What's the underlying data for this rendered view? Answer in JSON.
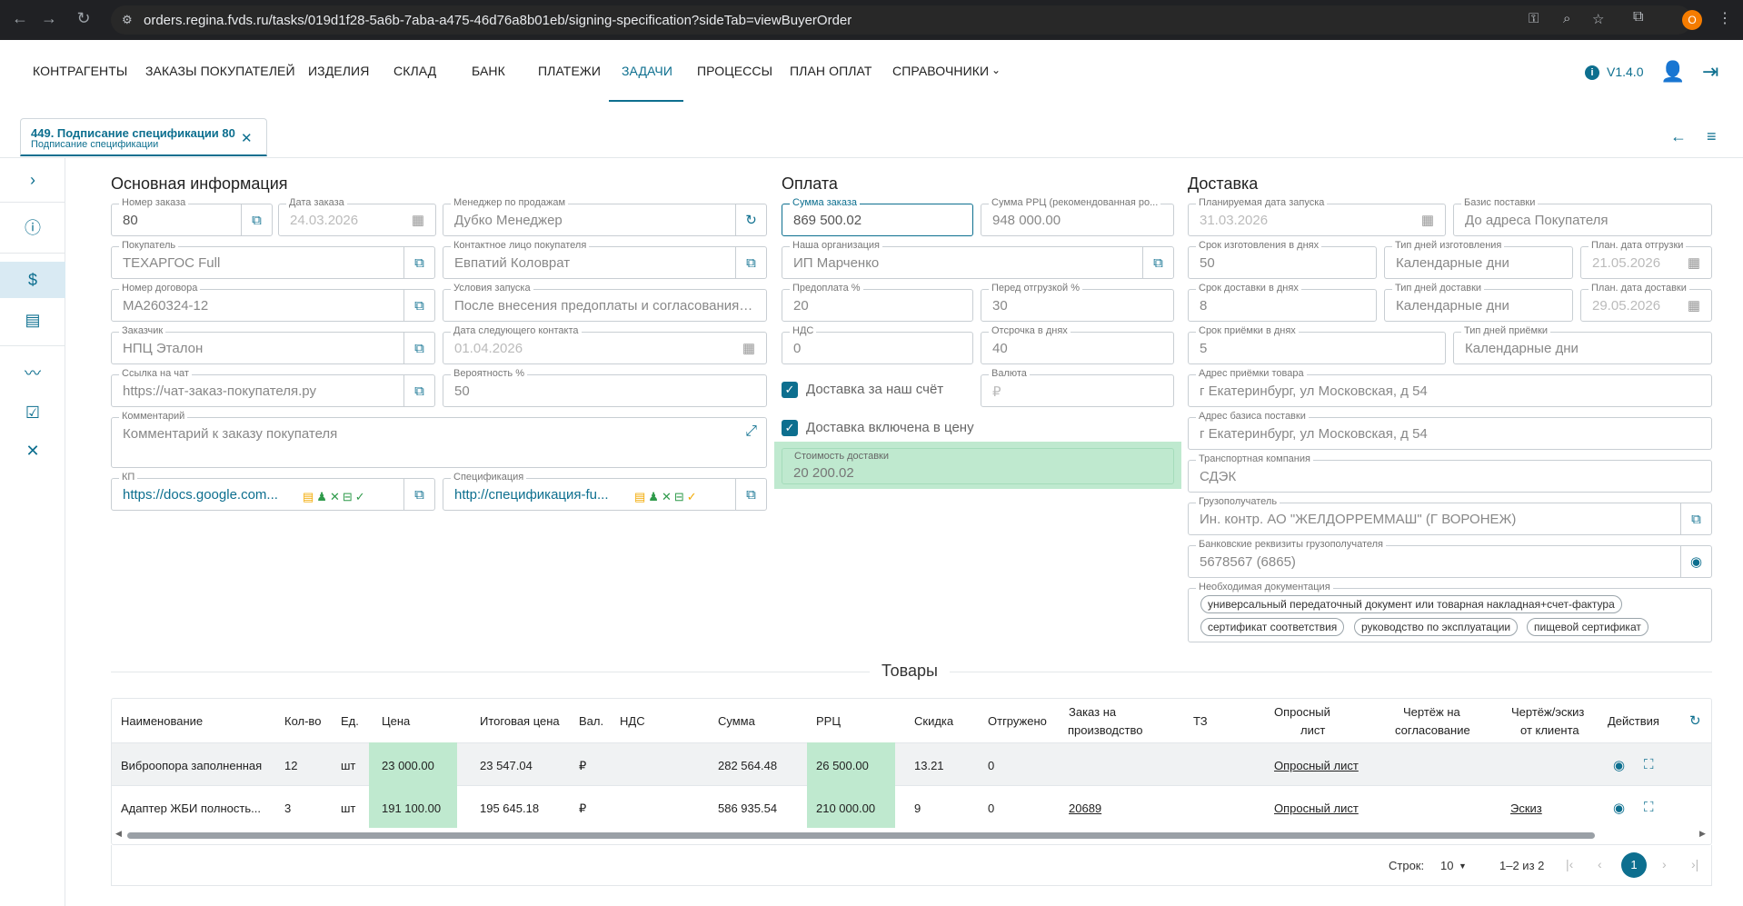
{
  "browser": {
    "url": "orders.regina.fvds.ru/tasks/019d1f28-5a6b-7aba-a475-46d76a8b01eb/signing-specification?sideTab=viewBuyerOrder",
    "avatar_letter": "O"
  },
  "nav": {
    "items": [
      "КОНТРАГЕНТЫ",
      "ЗАКАЗЫ ПОКУПАТЕЛЕЙ",
      "ИЗДЕЛИЯ",
      "СКЛАД",
      "БАНК",
      "ПЛАТЕЖИ",
      "ЗАДАЧИ",
      "ПРОЦЕССЫ",
      "ПЛАН ОПЛАТ",
      "СПРАВОЧНИКИ"
    ],
    "active": "ЗАДАЧИ",
    "version": "V1.4.0"
  },
  "tab": {
    "title": "449. Подписание спецификации 80",
    "subtitle": "Подписание спецификации"
  },
  "main": {
    "title": "Основная информация",
    "order_number": {
      "label": "Номер заказа",
      "value": "80"
    },
    "order_date": {
      "label": "Дата заказа",
      "value": "24.03.2026"
    },
    "manager": {
      "label": "Менеджер по продажам",
      "value": "Дубко Менеджер"
    },
    "buyer": {
      "label": "Покупатель",
      "value": "ТЕХАРГОС Full"
    },
    "contact": {
      "label": "Контактное лицо покупателя",
      "value": "Евпатий Коловрат"
    },
    "contract": {
      "label": "Номер договора",
      "value": "МА260324-12"
    },
    "launch_terms": {
      "label": "Условия запуска",
      "value": "После внесения предоплаты и согласования чертежей"
    },
    "customer": {
      "label": "Заказчик",
      "value": "НПЦ Эталон"
    },
    "next_contact": {
      "label": "Дата следующего контакта",
      "value": "01.04.2026"
    },
    "chat": {
      "label": "Ссылка на чат",
      "value": "https://чат-заказ-покупателя.ру"
    },
    "probability": {
      "label": "Вероятность %",
      "value": "50"
    },
    "comment": {
      "label": "Комментарий",
      "value": "Комментарий к заказу покупателя"
    },
    "kp": {
      "label": "КП",
      "value": "https://docs.google.com..."
    },
    "spec": {
      "label": "Спецификация",
      "value": "http://спецификация-fu..."
    }
  },
  "payment": {
    "title": "Оплата",
    "order_sum": {
      "label": "Сумма заказа",
      "value": "869 500.02"
    },
    "rrp_sum": {
      "label": "Сумма РРЦ (рекомендованная ро...",
      "value": "948 000.00"
    },
    "org": {
      "label": "Наша организация",
      "value": "ИП Марченко"
    },
    "prepay": {
      "label": "Предоплата %",
      "value": "20"
    },
    "before_ship": {
      "label": "Перед отгрузкой %",
      "value": "30"
    },
    "vat": {
      "label": "НДС",
      "value": "0"
    },
    "delay": {
      "label": "Отсрочка в днях",
      "value": "40"
    },
    "delivery_our": "Доставка за наш счёт",
    "currency": {
      "label": "Валюта",
      "value": "₽"
    },
    "delivery_included": "Доставка включена в цену",
    "delivery_cost": {
      "label": "Стоимость доставки",
      "value": "20 200.02"
    }
  },
  "delivery": {
    "title": "Доставка",
    "planned_launch": {
      "label": "Планируемая дата запуска",
      "value": "31.03.2026"
    },
    "basis": {
      "label": "Базис поставки",
      "value": "До адреса Покупателя"
    },
    "make_days": {
      "label": "Срок изготовления в днях",
      "value": "50"
    },
    "make_type": {
      "label": "Тип дней изготовления",
      "value": "Календарные дни"
    },
    "ship_date": {
      "label": "План. дата отгрузки",
      "value": "21.05.2026"
    },
    "deliv_days": {
      "label": "Срок доставки в днях",
      "value": "8"
    },
    "deliv_type": {
      "label": "Тип дней доставки",
      "value": "Календарные дни"
    },
    "deliv_date": {
      "label": "План. дата доставки",
      "value": "29.05.2026"
    },
    "accept_days": {
      "label": "Срок приёмки в днях",
      "value": "5"
    },
    "accept_type": {
      "label": "Тип дней приёмки",
      "value": "Календарные дни"
    },
    "accept_addr": {
      "label": "Адрес приёмки товара",
      "value": "г Екатеринбург, ул Московская, д 54"
    },
    "basis_addr": {
      "label": "Адрес базиса поставки",
      "value": "г Екатеринбург, ул Московская, д 54"
    },
    "transport": {
      "label": "Транспортная компания",
      "value": "СДЭК"
    },
    "consignee": {
      "label": "Грузополучатель",
      "value": "Ин. контр. АО \"ЖЕЛДОРРЕММАШ\" (Г ВОРОНЕЖ)"
    },
    "bank": {
      "label": "Банковские реквизиты грузополучателя",
      "value": "5678567 (6865)"
    },
    "docs_label": "Необходимая документация",
    "docs": [
      "универсальный передаточный документ или товарная накладная+счет-фактура",
      "сертификат соответствия",
      "руководство по эксплуатации",
      "пищевой сертификат"
    ]
  },
  "goods": {
    "title": "Товары",
    "headers": [
      "Наименование",
      "Кол-во",
      "Ед.",
      "Цена",
      "Итоговая цена",
      "Вал.",
      "НДС",
      "Сумма",
      "РРЦ",
      "Скидка",
      "Отгружено",
      "Заказ на",
      "производство",
      "ТЗ",
      "Опросный",
      "лист",
      "Чертёж на",
      "согласование",
      "Чертёж/эскиз",
      "от клиента",
      "Действия"
    ],
    "rows": [
      {
        "name": "Виброопора заполненная",
        "qty": "12",
        "unit": "шт",
        "price": "23 000.00",
        "total": "23 547.04",
        "cur": "₽",
        "vat": "",
        "sum": "282 564.48",
        "rrp": "26 500.00",
        "disc": "13.21",
        "shipped": "0",
        "prod": "",
        "tz": "",
        "survey": "Опросный лист",
        "draft": "",
        "sketch": ""
      },
      {
        "name": "Адаптер ЖБИ полность...",
        "qty": "3",
        "unit": "шт",
        "price": "191 100.00",
        "total": "195 645.18",
        "cur": "₽",
        "vat": "",
        "sum": "586 935.54",
        "rrp": "210 000.00",
        "disc": "9",
        "shipped": "0",
        "prod": "20689",
        "tz": "",
        "survey": "Опросный лист",
        "draft": "",
        "sketch": "Эскиз"
      }
    ]
  },
  "pagination": {
    "rows_label": "Строк:",
    "rows_value": "10",
    "range": "1–2 из 2",
    "page": "1"
  }
}
